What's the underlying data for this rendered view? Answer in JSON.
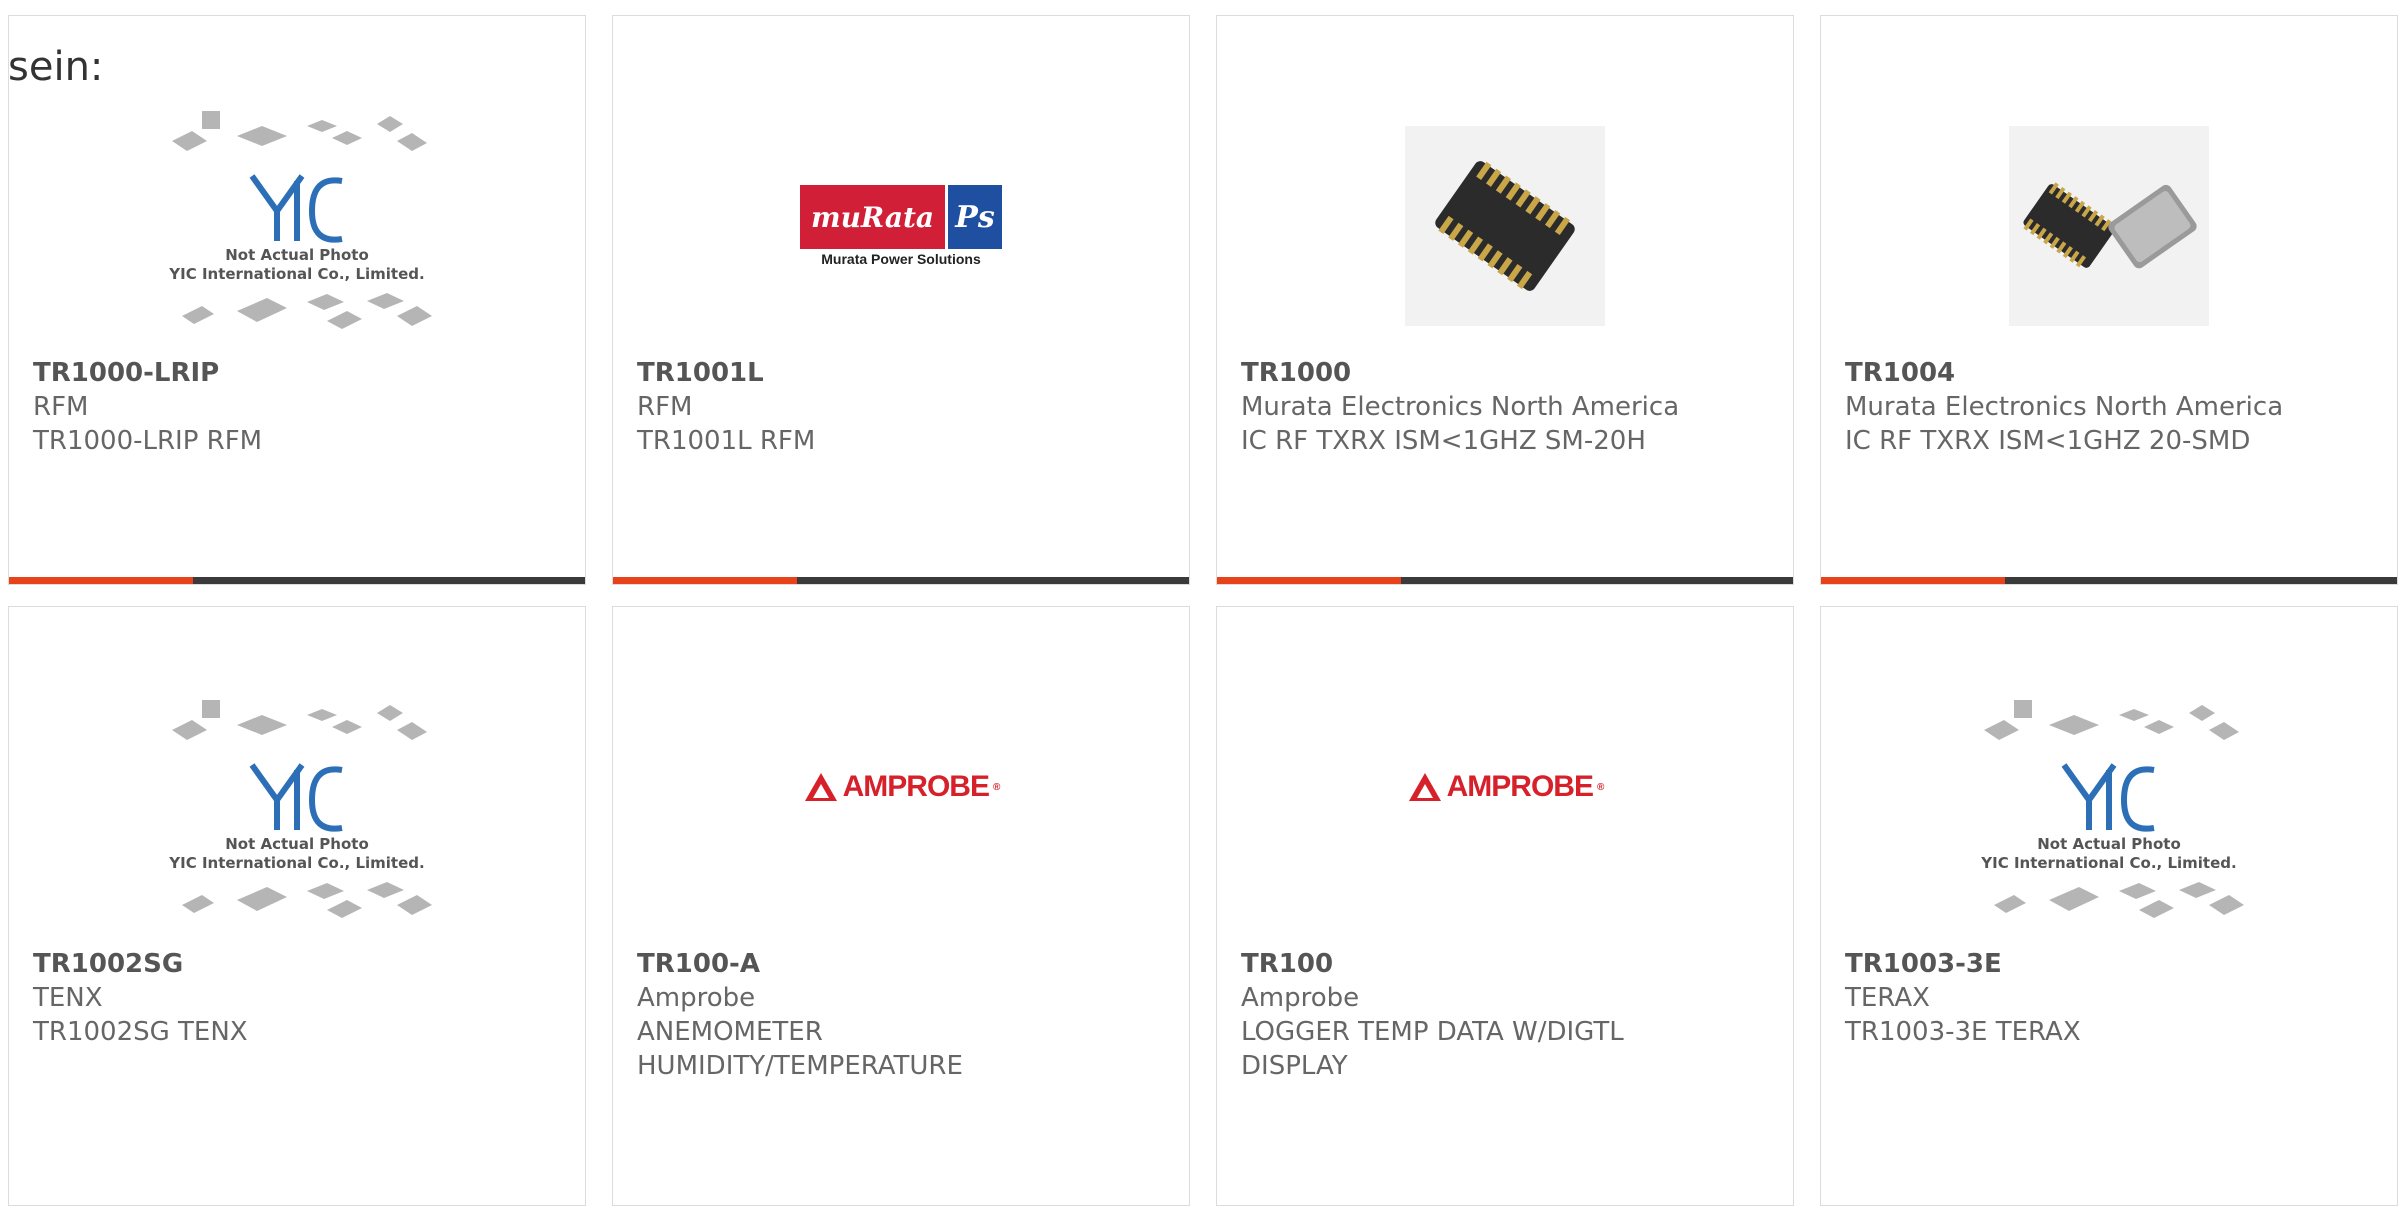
{
  "header": {
    "text": "sein:"
  },
  "products": [
    {
      "part": "TR1000-LRIP",
      "maker": "RFM",
      "desc": [
        "TR1000-LRIP RFM"
      ],
      "image": "yic-placeholder"
    },
    {
      "part": "TR1001L",
      "maker": "RFM",
      "desc": [
        "TR1001L RFM"
      ],
      "image": "murata-logo"
    },
    {
      "part": "TR1000",
      "maker": "Murata Electronics North America",
      "desc": [
        "IC RF TXRX ISM<1GHZ SM-20H"
      ],
      "image": "smd-chip"
    },
    {
      "part": "TR1004",
      "maker": "Murata Electronics North America",
      "desc": [
        "IC RF TXRX ISM<1GHZ 20-SMD"
      ],
      "image": "smd-chip-pair"
    },
    {
      "part": "TR1002SG",
      "maker": "TENX",
      "desc": [
        "TR1002SG TENX"
      ],
      "image": "yic-placeholder"
    },
    {
      "part": "TR100-A",
      "maker": "Amprobe",
      "desc": [
        "ANEMOMETER",
        "HUMIDITY/TEMPERATURE"
      ],
      "image": "amprobe-logo"
    },
    {
      "part": "TR100",
      "maker": "Amprobe",
      "desc": [
        "LOGGER TEMP DATA W/DIGTL",
        "DISPLAY"
      ],
      "image": "amprobe-logo"
    },
    {
      "part": "TR1003-3E",
      "maker": "TERAX",
      "desc": [
        "TR1003-3E TERAX"
      ],
      "image": "yic-placeholder"
    }
  ],
  "placeholder": {
    "line1": "Not Actual Photo",
    "line2": "YIC International Co., Limited.",
    "logo": "YIC"
  },
  "logos": {
    "murata_main": "muRata",
    "murata_ps": "Ps",
    "murata_sub": "Murata Power Solutions",
    "amprobe": "AMPROBE",
    "amprobe_mark": "®"
  },
  "colors": {
    "accent": "#e8421a",
    "bar": "#3a3a3a",
    "murata_red": "#d01f36",
    "murata_blue": "#1e4fa1",
    "amprobe_red": "#d6202a"
  }
}
